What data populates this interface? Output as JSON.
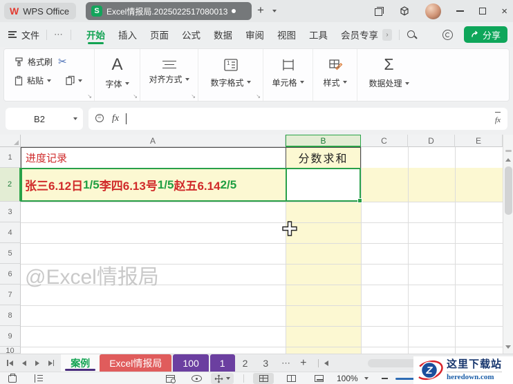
{
  "titlebar": {
    "app_name": "WPS Office",
    "app_logo_letter": "W",
    "doc_title": "Excel情报局.2025022517080013",
    "doc_icon_letter": "S"
  },
  "menubar": {
    "file": "文件",
    "more": "⋯",
    "items": [
      "开始",
      "插入",
      "页面",
      "公式",
      "数据",
      "审阅",
      "视图",
      "工具",
      "会员专享"
    ],
    "expand": "›",
    "share": "分享"
  },
  "ribbon": {
    "format_painter": "格式刷",
    "paste": "粘贴",
    "scissors_glyph": "✂",
    "font": "字体",
    "font_icon_letter": "A",
    "align": "对齐方式",
    "number_format": "数字格式",
    "number_icon_digit": "1",
    "cells": "单元格",
    "styles": "样式",
    "data_tools": "数据处理",
    "sigma_glyph": "Σ"
  },
  "formula_bar": {
    "name_box": "B2",
    "fx_label": "fx",
    "input_value": ""
  },
  "grid": {
    "col_headers": [
      "A",
      "B",
      "C",
      "D",
      "E"
    ],
    "row_headers": [
      "1",
      "2",
      "3",
      "4",
      "5",
      "6",
      "7",
      "8",
      "9",
      "10"
    ],
    "cells": {
      "a1": "进度记录",
      "b1": "分数求和",
      "b2": ""
    },
    "a2_runs": [
      {
        "text": "张三6.12日 ",
        "color": "red"
      },
      {
        "text": "1/5",
        "color": "green"
      },
      {
        "text": "李四6.13号 ",
        "color": "red"
      },
      {
        "text": "1/5",
        "color": "green"
      },
      {
        "text": "赵五6.14 ",
        "color": "red"
      },
      {
        "text": "2/5",
        "color": "green"
      }
    ],
    "watermark": "@Excel情报局"
  },
  "sheet_tabs": {
    "items": [
      {
        "label": "案例",
        "style": "active"
      },
      {
        "label": "Excel情报局",
        "style": "red"
      },
      {
        "label": "100",
        "style": "purple"
      },
      {
        "label": "1",
        "style": "purple"
      },
      {
        "label": "2",
        "style": "plain"
      },
      {
        "label": "3",
        "style": "plain"
      }
    ],
    "more": "⋯",
    "add": "+"
  },
  "status_bar": {
    "zoom_level": "100%"
  },
  "overlay_badge": {
    "site_name": "这里下载站",
    "site_url": "heredown.com",
    "logo_letter": "Z"
  },
  "colors": {
    "accent_green": "#12a352",
    "selection_green": "#28a049",
    "cell_red_text": "#d02a2a",
    "cell_green_text": "#1f9e42",
    "highlight_yellow": "#fcf8d2",
    "tab_red": "#e05c5c",
    "tab_purple": "#6b3fa0",
    "tab_underline_purple": "#4a2d7d",
    "badge_blue": "#1b4f9c",
    "badge_red": "#d8232a"
  }
}
